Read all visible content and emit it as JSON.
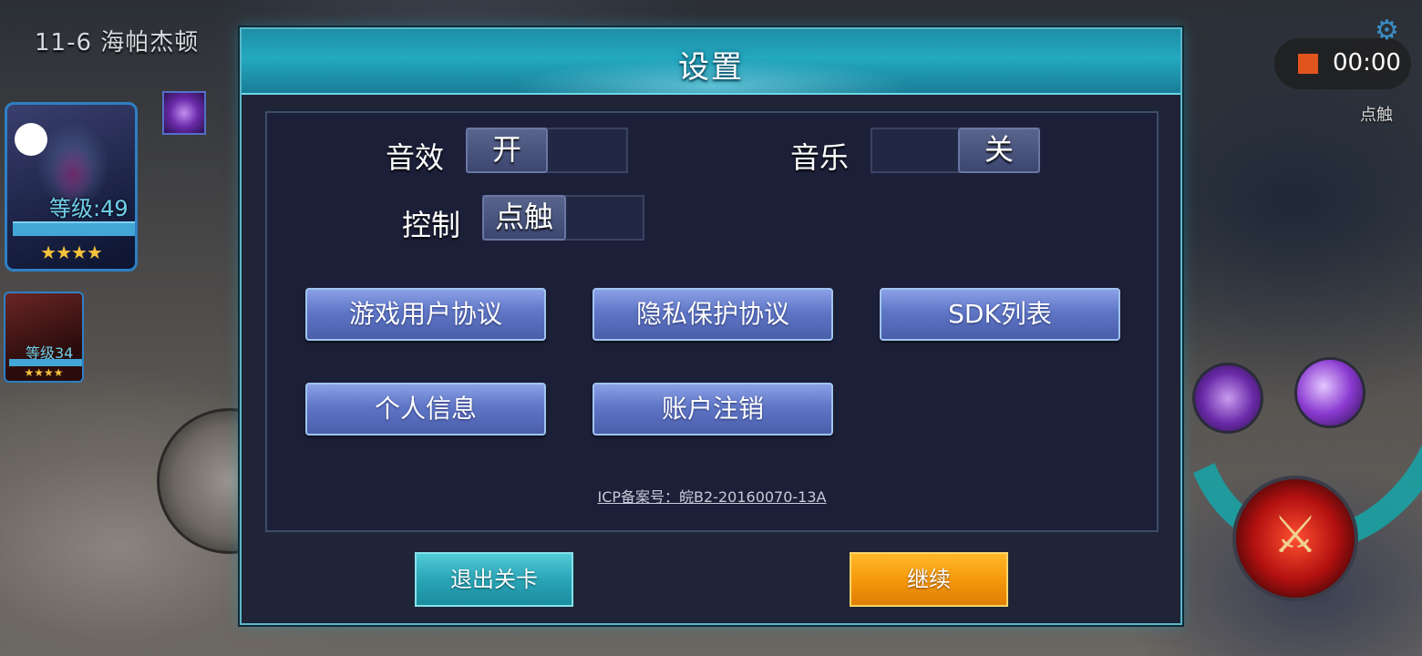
{
  "hud": {
    "stage_title": "11-6 海帕杰顿",
    "hero1": {
      "level": "等级:49",
      "stars": "★★★★"
    },
    "hero2": {
      "level": "等级34",
      "stars": "★★★★"
    },
    "recorder": {
      "time": "00:00"
    },
    "control_tag": "点触",
    "icons": {
      "gear": "gear-icon",
      "record": "record-stop-icon",
      "attack": "crossed-swords-icon"
    }
  },
  "dialog": {
    "title": "设置",
    "sound": {
      "label": "音效",
      "state": "开"
    },
    "music": {
      "label": "音乐",
      "state": "关"
    },
    "control": {
      "label": "控制",
      "state": "点触"
    },
    "buttons": {
      "user_agreement": "游戏用户协议",
      "privacy": "隐私保护协议",
      "sdk_list": "SDK列表",
      "personal_info": "个人信息",
      "account_cancel": "账户注销"
    },
    "icp": "ICP备案号：皖B2-20160070-13A",
    "exit": "退出关卡",
    "continue": "继续"
  },
  "colors": {
    "header_teal": "#23a9c0",
    "panel_bg": "#1c1f38",
    "blue_button": "#5f76c6",
    "exit_teal": "#2aa5b6",
    "continue_orange": "#f59a0c"
  }
}
